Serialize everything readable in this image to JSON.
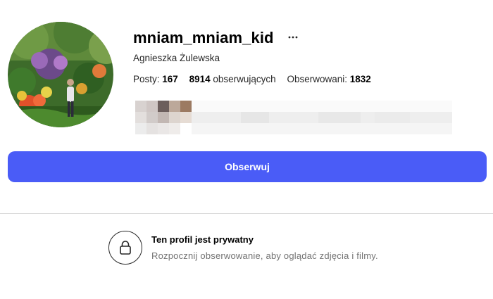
{
  "profile": {
    "username": "mniam_mniam_kid",
    "full_name": "Agnieszka Żulewska",
    "avatar_icon": "profile-photo",
    "more_icon": "ellipsis-icon"
  },
  "stats": {
    "posts_label": "Posty:",
    "posts_value": "167",
    "followers_value": "8914",
    "followers_label": "obserwujących",
    "following_label": "Obserwowani:",
    "following_value": "1832"
  },
  "actions": {
    "follow_label": "Obserwuj"
  },
  "private_notice": {
    "icon": "lock-icon",
    "title": "Ten profil jest prywatny",
    "subtitle": "Rozpocznij obserwowanie, aby oglądać zdjęcia i filmy."
  },
  "colors": {
    "accent": "#4a5cf7",
    "divider": "#dbdbdb",
    "muted_text": "#737373"
  }
}
